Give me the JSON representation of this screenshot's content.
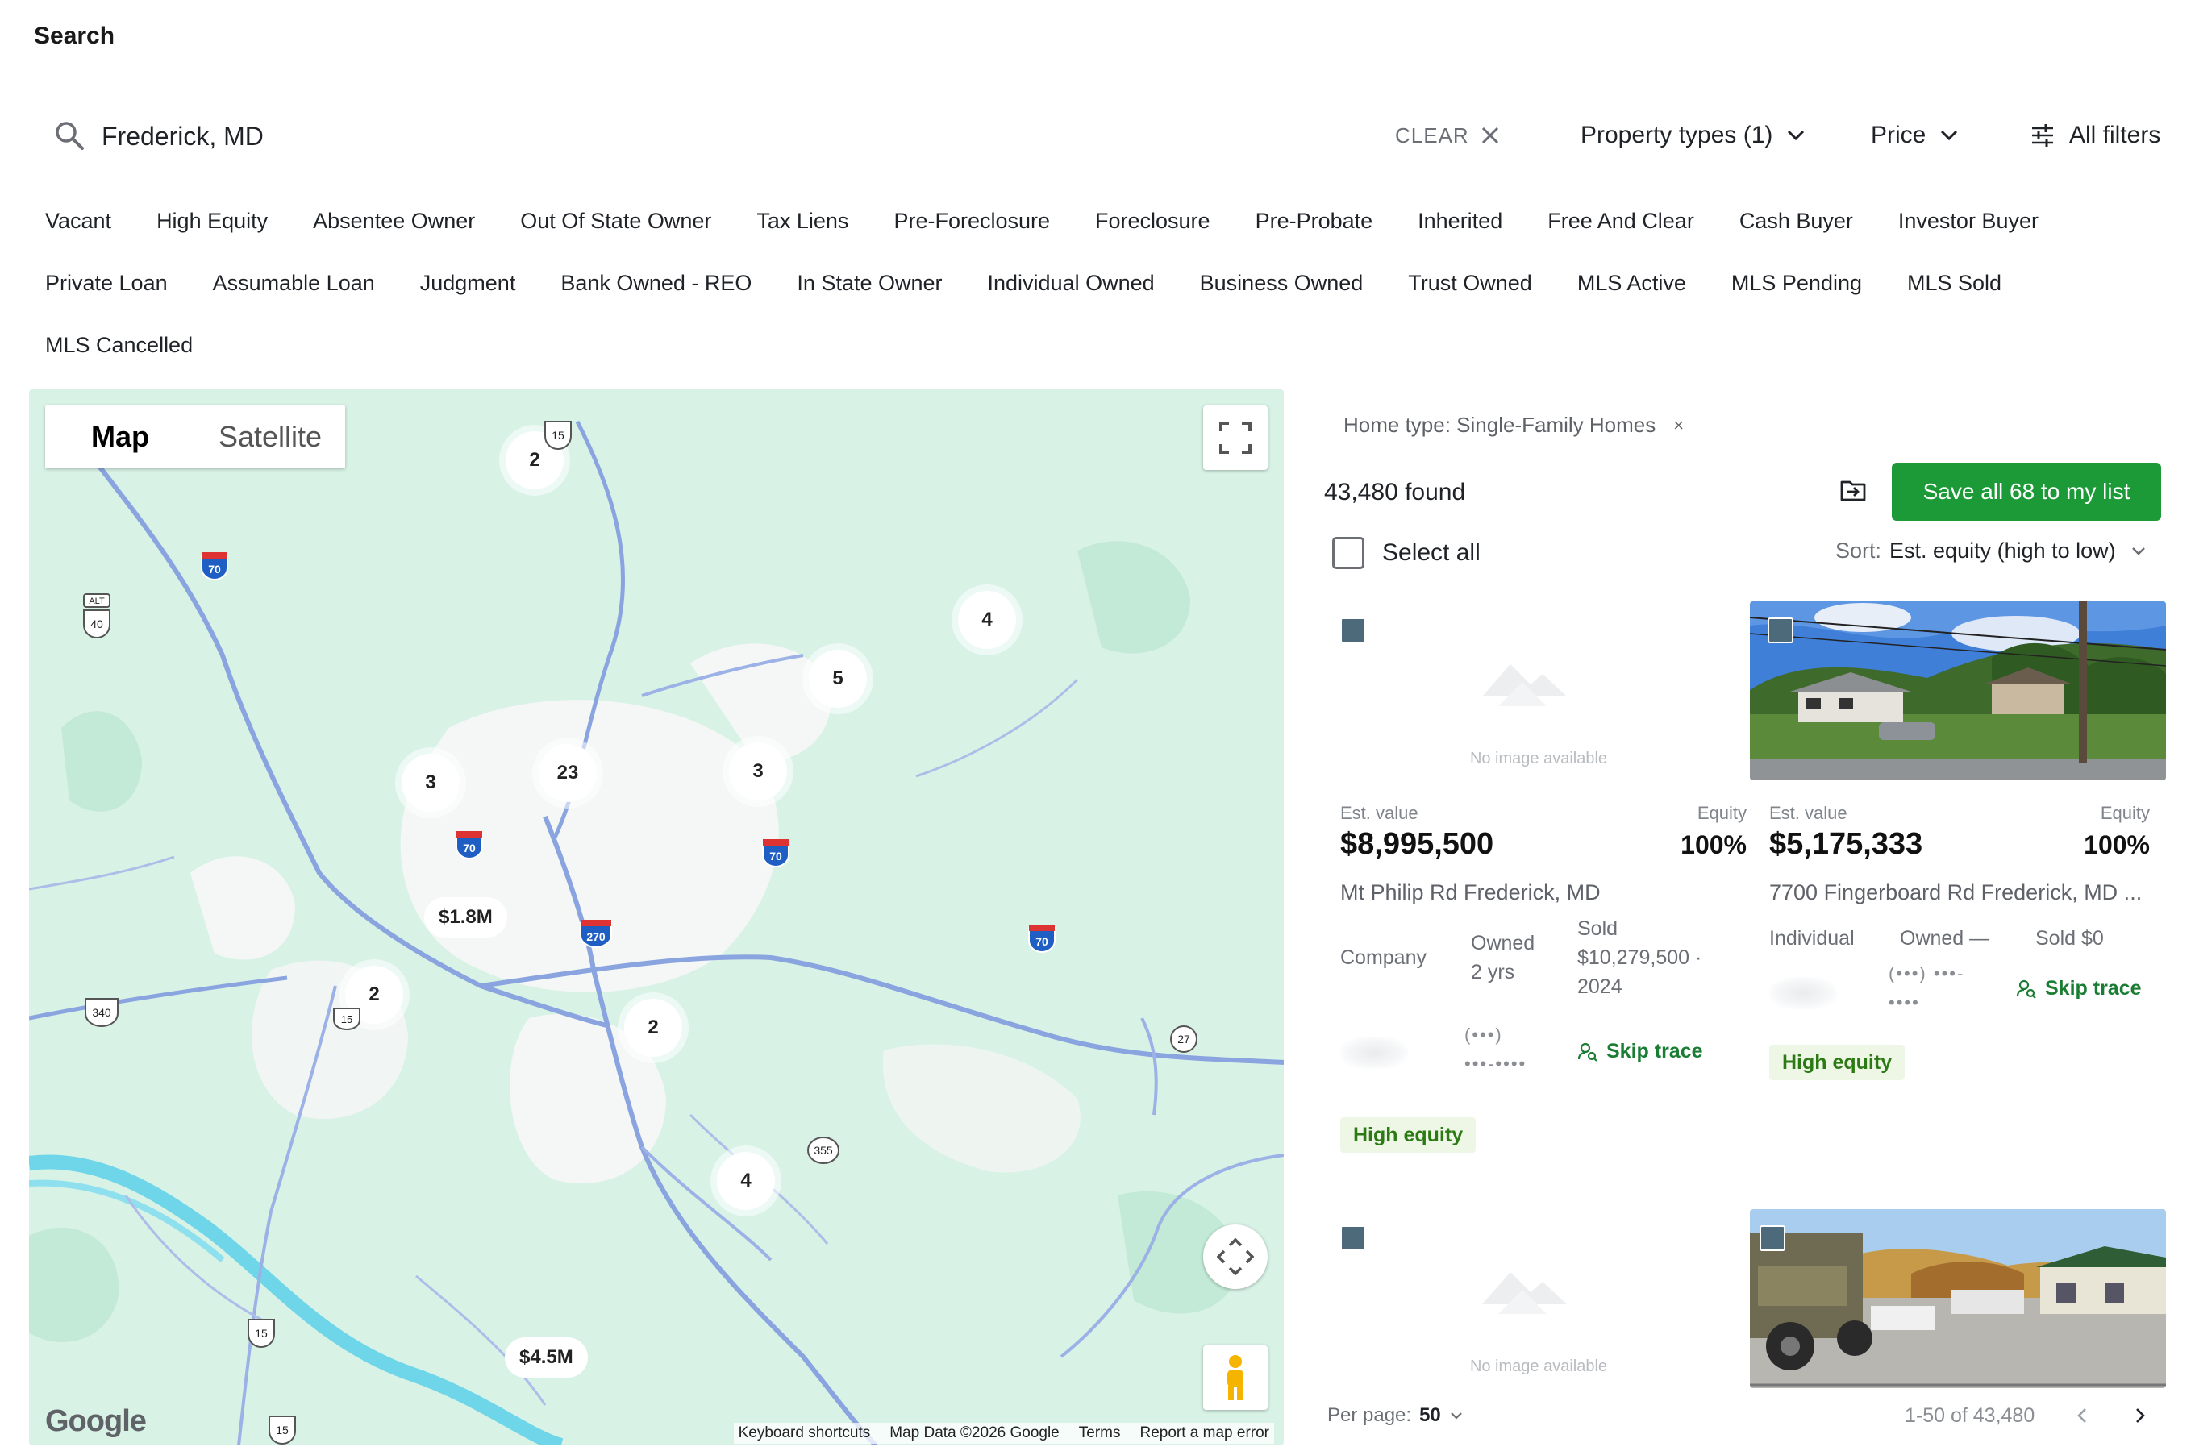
{
  "page": {
    "title": "Search"
  },
  "search": {
    "value": "Frederick, MD",
    "clear_label": "CLEAR",
    "property_types_label": "Property types (1)",
    "price_label": "Price",
    "all_filters_label": "All filters"
  },
  "chips": [
    "Vacant",
    "High Equity",
    "Absentee Owner",
    "Out Of State Owner",
    "Tax Liens",
    "Pre-Foreclosure",
    "Foreclosure",
    "Pre-Probate",
    "Inherited",
    "Free And Clear",
    "Cash Buyer",
    "Investor Buyer",
    "Private Loan",
    "Assumable Loan",
    "Judgment",
    "Bank Owned - REO",
    "In State Owner",
    "Individual Owned",
    "Business Owned",
    "Trust Owned",
    "MLS Active",
    "MLS Pending",
    "MLS Sold",
    "MLS Cancelled"
  ],
  "map": {
    "toggle_map": "Map",
    "toggle_satellite": "Satellite",
    "clusters": [
      "2",
      "4",
      "5",
      "3",
      "23",
      "3",
      "2",
      "2",
      "4"
    ],
    "price_pins": [
      "$1.8M",
      "$4.5M"
    ],
    "shields": [
      "15",
      "70",
      "40",
      "70",
      "70",
      "270",
      "70",
      "340",
      "15",
      "27",
      "355",
      "15",
      "15"
    ],
    "shield_alt": "ALT",
    "logo": "Google",
    "footer": {
      "shortcuts": "Keyboard shortcuts",
      "map_data": "Map Data ©2026 Google",
      "terms": "Terms",
      "report": "Report a map error"
    }
  },
  "results": {
    "filter_tag": "Home type: Single-Family Homes",
    "filter_tag_close": "×",
    "found": "43,480 found",
    "save_label": "Save all 68 to my list",
    "select_all": "Select all",
    "sort_label": "Sort:",
    "sort_value": "Est. equity (high to low)",
    "per_page_label": "Per page:",
    "per_page_value": "50",
    "range": "1-50 of 43,480"
  },
  "cards": [
    {
      "no_image": "No image available",
      "est_value_label": "Est. value",
      "est_value": "$8,995,500",
      "equity_label": "Equity",
      "equity": "100%",
      "address": "Mt Philip Rd Frederick, MD",
      "owner_type": "Company",
      "owned_label": "Owned",
      "owned_value": "2 yrs",
      "sold_label": "Sold",
      "sold_line1": "$10,279,500 ·",
      "sold_line2": "2024",
      "phone_line1": "(•••)",
      "phone_line2": "•••-••••",
      "skip_trace": "Skip trace",
      "badge": "High equity"
    },
    {
      "est_value_label": "Est. value",
      "est_value": "$5,175,333",
      "equity_label": "Equity",
      "equity": "100%",
      "address": "7700 Fingerboard Rd Frederick, MD ...",
      "owner_type": "Individual",
      "owned_label": "Owned —",
      "sold_label": "Sold $0",
      "phone_line1": "(•••) •••-",
      "phone_line2": "••••",
      "skip_trace": "Skip trace",
      "badge": "High equity"
    },
    {
      "no_image": "No image available"
    }
  ],
  "colors": {
    "accent_green": "#1b9a37",
    "map_land": "#d8f2e6",
    "highway": "#8aa4e0",
    "badge_bg": "#eef7e6"
  }
}
